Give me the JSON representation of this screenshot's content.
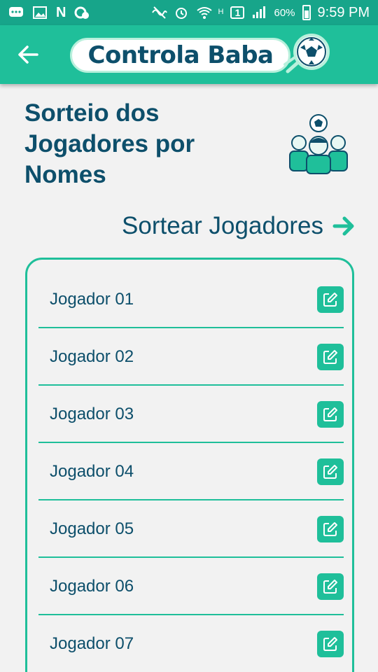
{
  "status_bar": {
    "battery": "60%",
    "time": "9:59 PM",
    "n_glyph": "N",
    "h_glyph": "H",
    "sim_glyph": "1"
  },
  "app_bar": {
    "logo_text": "Controla Baba",
    "back_icon": "arrow-left-icon"
  },
  "page": {
    "title": "Sorteio dos Jogadores por Nomes",
    "draw_label": "Sortear Jogadores"
  },
  "players": [
    {
      "name": "Jogador 01"
    },
    {
      "name": "Jogador 02"
    },
    {
      "name": "Jogador 03"
    },
    {
      "name": "Jogador 04"
    },
    {
      "name": "Jogador 05"
    },
    {
      "name": "Jogador 06"
    },
    {
      "name": "Jogador 07"
    }
  ],
  "colors": {
    "primary": "#1fbf9a",
    "status": "#17a58a",
    "text": "#0d4f6b",
    "background": "#f2f2f2"
  }
}
